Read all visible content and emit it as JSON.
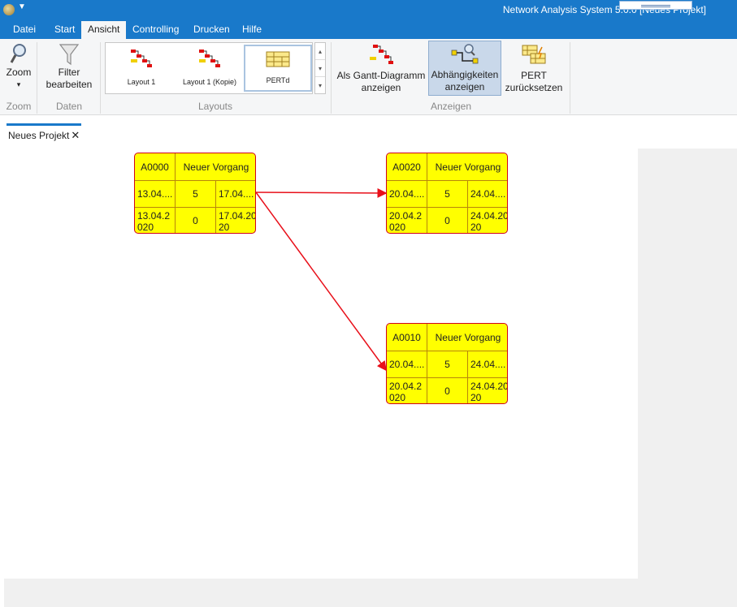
{
  "window": {
    "title": "Network Analysis System 5.0.0 [Neues Projekt]"
  },
  "tabs": [
    {
      "label": "Datei",
      "active": false
    },
    {
      "label": "Start",
      "active": false
    },
    {
      "label": "Ansicht",
      "active": true
    },
    {
      "label": "Controlling",
      "active": false
    },
    {
      "label": "Drucken",
      "active": false
    },
    {
      "label": "Hilfe",
      "active": false
    }
  ],
  "ribbon": {
    "zoom": {
      "label": "Zoom",
      "dropdown": "▾",
      "group": "Zoom",
      "icon": "magnifier-icon"
    },
    "filter": {
      "label_line1": "Filter",
      "label_line2": "bearbeiten",
      "group": "Daten",
      "icon": "funnel-icon"
    },
    "layouts": {
      "group": "Layouts",
      "items": [
        {
          "label": "Layout 1",
          "icon": "gantt-layout-icon",
          "selected": false
        },
        {
          "label": "Layout 1 (Kopie)",
          "icon": "gantt-layout-icon",
          "selected": false
        },
        {
          "label": "PERTd",
          "icon": "pert-table-icon",
          "selected": true
        }
      ],
      "scroll_up": "▴",
      "scroll_down": "▾",
      "more": "▾"
    },
    "anzeigen": {
      "group": "Anzeigen",
      "gantt": {
        "label_line1": "Als Gantt-Diagramm",
        "label_line2": "anzeigen",
        "icon": "gantt-view-icon"
      },
      "dependencies": {
        "label_line1": "Abhängigkeiten",
        "label_line2": "anzeigen",
        "icon": "dependencies-icon",
        "pressed": true
      },
      "pert_reset": {
        "label_line1": "PERT",
        "label_line2": "zurücksetzen",
        "icon": "pert-reset-icon"
      }
    }
  },
  "document_tab": {
    "label": "Neues Projekt",
    "close": "✕"
  },
  "nodes": [
    {
      "id": "A0000",
      "name": "Neuer Vorgang",
      "start": "13.04....",
      "duration": "5",
      "end": "17.04....",
      "late_start": "13.04.2020",
      "float": "0",
      "late_end": "17.04.2020"
    },
    {
      "id": "A0020",
      "name": "Neuer Vorgang",
      "start": "20.04....",
      "duration": "5",
      "end": "24.04....",
      "late_start": "20.04.2020",
      "float": "0",
      "late_end": "24.04.2020"
    },
    {
      "id": "A0010",
      "name": "Neuer Vorgang",
      "start": "20.04....",
      "duration": "5",
      "end": "24.04....",
      "late_start": "20.04.2020",
      "float": "0",
      "late_end": "24.04.2020"
    }
  ],
  "colors": {
    "accent": "#1979ca",
    "node_fill": "#ffff00",
    "node_border": "#d0021b",
    "link": "#e8101a"
  }
}
